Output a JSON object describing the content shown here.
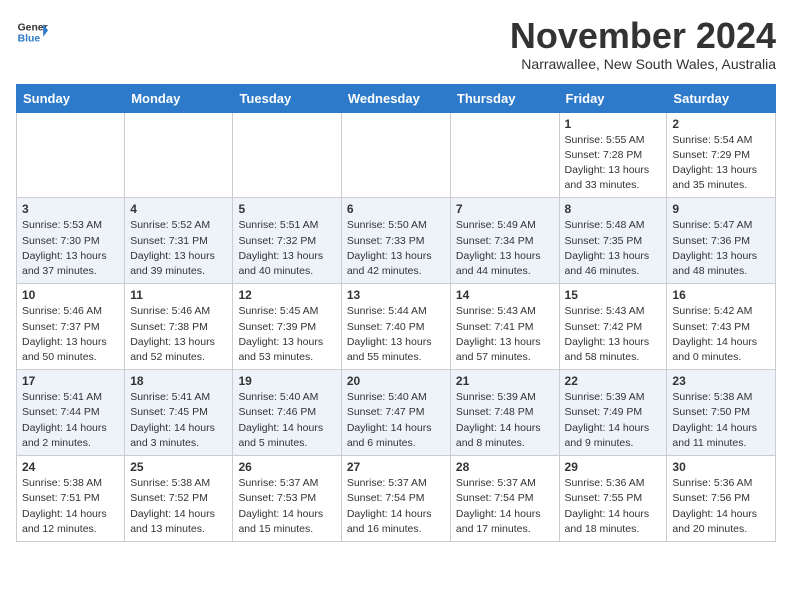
{
  "header": {
    "logo_line1": "General",
    "logo_line2": "Blue",
    "month_title": "November 2024",
    "location": "Narrawallee, New South Wales, Australia"
  },
  "days_of_week": [
    "Sunday",
    "Monday",
    "Tuesday",
    "Wednesday",
    "Thursday",
    "Friday",
    "Saturday"
  ],
  "weeks": [
    [
      {
        "day": "",
        "info": ""
      },
      {
        "day": "",
        "info": ""
      },
      {
        "day": "",
        "info": ""
      },
      {
        "day": "",
        "info": ""
      },
      {
        "day": "",
        "info": ""
      },
      {
        "day": "1",
        "info": "Sunrise: 5:55 AM\nSunset: 7:28 PM\nDaylight: 13 hours and 33 minutes."
      },
      {
        "day": "2",
        "info": "Sunrise: 5:54 AM\nSunset: 7:29 PM\nDaylight: 13 hours and 35 minutes."
      }
    ],
    [
      {
        "day": "3",
        "info": "Sunrise: 5:53 AM\nSunset: 7:30 PM\nDaylight: 13 hours and 37 minutes."
      },
      {
        "day": "4",
        "info": "Sunrise: 5:52 AM\nSunset: 7:31 PM\nDaylight: 13 hours and 39 minutes."
      },
      {
        "day": "5",
        "info": "Sunrise: 5:51 AM\nSunset: 7:32 PM\nDaylight: 13 hours and 40 minutes."
      },
      {
        "day": "6",
        "info": "Sunrise: 5:50 AM\nSunset: 7:33 PM\nDaylight: 13 hours and 42 minutes."
      },
      {
        "day": "7",
        "info": "Sunrise: 5:49 AM\nSunset: 7:34 PM\nDaylight: 13 hours and 44 minutes."
      },
      {
        "day": "8",
        "info": "Sunrise: 5:48 AM\nSunset: 7:35 PM\nDaylight: 13 hours and 46 minutes."
      },
      {
        "day": "9",
        "info": "Sunrise: 5:47 AM\nSunset: 7:36 PM\nDaylight: 13 hours and 48 minutes."
      }
    ],
    [
      {
        "day": "10",
        "info": "Sunrise: 5:46 AM\nSunset: 7:37 PM\nDaylight: 13 hours and 50 minutes."
      },
      {
        "day": "11",
        "info": "Sunrise: 5:46 AM\nSunset: 7:38 PM\nDaylight: 13 hours and 52 minutes."
      },
      {
        "day": "12",
        "info": "Sunrise: 5:45 AM\nSunset: 7:39 PM\nDaylight: 13 hours and 53 minutes."
      },
      {
        "day": "13",
        "info": "Sunrise: 5:44 AM\nSunset: 7:40 PM\nDaylight: 13 hours and 55 minutes."
      },
      {
        "day": "14",
        "info": "Sunrise: 5:43 AM\nSunset: 7:41 PM\nDaylight: 13 hours and 57 minutes."
      },
      {
        "day": "15",
        "info": "Sunrise: 5:43 AM\nSunset: 7:42 PM\nDaylight: 13 hours and 58 minutes."
      },
      {
        "day": "16",
        "info": "Sunrise: 5:42 AM\nSunset: 7:43 PM\nDaylight: 14 hours and 0 minutes."
      }
    ],
    [
      {
        "day": "17",
        "info": "Sunrise: 5:41 AM\nSunset: 7:44 PM\nDaylight: 14 hours and 2 minutes."
      },
      {
        "day": "18",
        "info": "Sunrise: 5:41 AM\nSunset: 7:45 PM\nDaylight: 14 hours and 3 minutes."
      },
      {
        "day": "19",
        "info": "Sunrise: 5:40 AM\nSunset: 7:46 PM\nDaylight: 14 hours and 5 minutes."
      },
      {
        "day": "20",
        "info": "Sunrise: 5:40 AM\nSunset: 7:47 PM\nDaylight: 14 hours and 6 minutes."
      },
      {
        "day": "21",
        "info": "Sunrise: 5:39 AM\nSunset: 7:48 PM\nDaylight: 14 hours and 8 minutes."
      },
      {
        "day": "22",
        "info": "Sunrise: 5:39 AM\nSunset: 7:49 PM\nDaylight: 14 hours and 9 minutes."
      },
      {
        "day": "23",
        "info": "Sunrise: 5:38 AM\nSunset: 7:50 PM\nDaylight: 14 hours and 11 minutes."
      }
    ],
    [
      {
        "day": "24",
        "info": "Sunrise: 5:38 AM\nSunset: 7:51 PM\nDaylight: 14 hours and 12 minutes."
      },
      {
        "day": "25",
        "info": "Sunrise: 5:38 AM\nSunset: 7:52 PM\nDaylight: 14 hours and 13 minutes."
      },
      {
        "day": "26",
        "info": "Sunrise: 5:37 AM\nSunset: 7:53 PM\nDaylight: 14 hours and 15 minutes."
      },
      {
        "day": "27",
        "info": "Sunrise: 5:37 AM\nSunset: 7:54 PM\nDaylight: 14 hours and 16 minutes."
      },
      {
        "day": "28",
        "info": "Sunrise: 5:37 AM\nSunset: 7:54 PM\nDaylight: 14 hours and 17 minutes."
      },
      {
        "day": "29",
        "info": "Sunrise: 5:36 AM\nSunset: 7:55 PM\nDaylight: 14 hours and 18 minutes."
      },
      {
        "day": "30",
        "info": "Sunrise: 5:36 AM\nSunset: 7:56 PM\nDaylight: 14 hours and 20 minutes."
      }
    ]
  ]
}
